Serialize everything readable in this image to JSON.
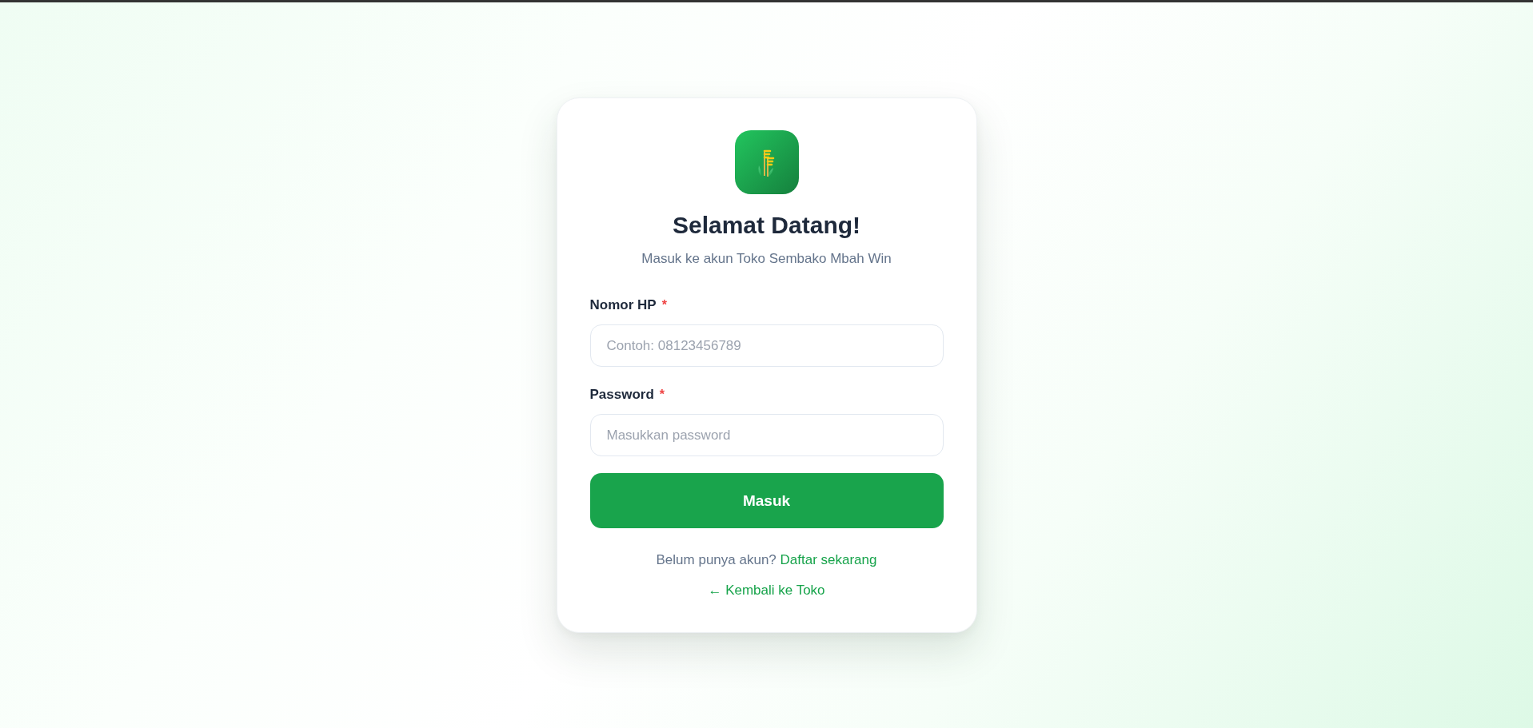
{
  "heading": {
    "title": "Selamat Datang!",
    "subtitle": "Masuk ke akun Toko Sembako Mbah Win"
  },
  "fields": [
    {
      "label": "Nomor HP",
      "required_mark": "*",
      "placeholder": "Contoh: 08123456789"
    },
    {
      "label": "Password",
      "required_mark": "*",
      "placeholder": "Masukkan password"
    }
  ],
  "submit_button": "Masuk",
  "signup": {
    "prompt": "Belum punya akun?",
    "link": "Daftar sekarang"
  },
  "back_link": "← Kembali ke Toko"
}
